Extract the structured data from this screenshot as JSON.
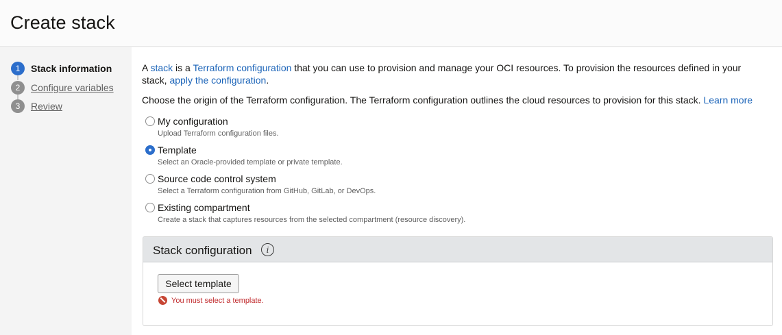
{
  "header": {
    "title": "Create stack"
  },
  "steps": [
    {
      "number": "1",
      "label": "Stack information",
      "active": true
    },
    {
      "number": "2",
      "label": "Configure variables",
      "active": false
    },
    {
      "number": "3",
      "label": "Review",
      "active": false
    }
  ],
  "intro": {
    "p1_a": "A ",
    "p1_link1": "stack",
    "p1_b": " is a ",
    "p1_link2": "Terraform configuration",
    "p1_c": " that you can use to provision and manage your OCI resources. To provision the resources defined in your stack, ",
    "p1_link3": "apply the configuration",
    "p1_d": ".",
    "origin_text": "Choose the origin of the Terraform configuration. The Terraform configuration outlines the cloud resources to provision for this stack. ",
    "learn_more": "Learn more"
  },
  "origin_options": [
    {
      "label": "My configuration",
      "description": "Upload Terraform configuration files.",
      "checked": false
    },
    {
      "label": "Template",
      "description": "Select an Oracle-provided template or private template.",
      "checked": true
    },
    {
      "label": "Source code control system",
      "description": "Select a Terraform configuration from GitHub, GitLab, or DevOps.",
      "checked": false
    },
    {
      "label": "Existing compartment",
      "description": "Create a stack that captures resources from the selected compartment (resource discovery).",
      "checked": false
    }
  ],
  "stack_config": {
    "title": "Stack configuration",
    "info_icon": "info-icon",
    "select_button": "Select template",
    "error": "You must select a template."
  },
  "colors": {
    "accent": "#2c6ecb",
    "link": "#1a63b8",
    "error": "#c0282b"
  }
}
